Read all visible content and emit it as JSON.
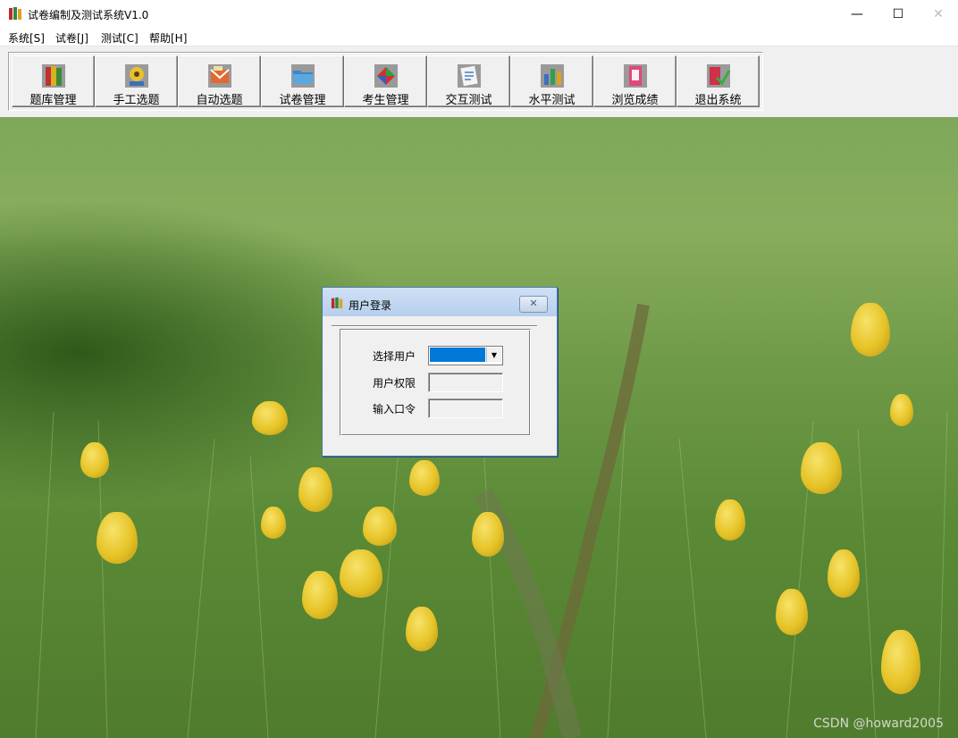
{
  "window": {
    "title": "试卷编制及测试系统V1.0",
    "minimize_glyph": "—",
    "maximize_glyph": "☐",
    "close_glyph": "✕"
  },
  "menu": [
    {
      "label": "系统[S]"
    },
    {
      "label": "试卷[J]"
    },
    {
      "label": "测试[C]"
    },
    {
      "label": "帮助[H]"
    }
  ],
  "toolbar": [
    {
      "label": "题库管理",
      "icon": "book-icon"
    },
    {
      "label": "手工选题",
      "icon": "film-icon"
    },
    {
      "label": "自动选题",
      "icon": "mail-icon"
    },
    {
      "label": "试卷管理",
      "icon": "folder-icon"
    },
    {
      "label": "考生管理",
      "icon": "people-icon"
    },
    {
      "label": "交互测试",
      "icon": "document-icon"
    },
    {
      "label": "水平测试",
      "icon": "chart-icon"
    },
    {
      "label": "浏览成绩",
      "icon": "report-icon"
    },
    {
      "label": "退出系统",
      "icon": "exit-icon"
    }
  ],
  "login_dialog": {
    "title": "用户登录",
    "close_glyph": "✕",
    "select_user_label": "选择用户",
    "user_permission_label": "用户权限",
    "password_label": "输入口令",
    "combo_arrow": "▼"
  },
  "watermark": "CSDN @howard2005",
  "colors": {
    "selection_blue": "#0078d7",
    "dialog_border": "#4a78b0",
    "grass_green": "#6f9a48",
    "flower_yellow": "#e6c326"
  }
}
